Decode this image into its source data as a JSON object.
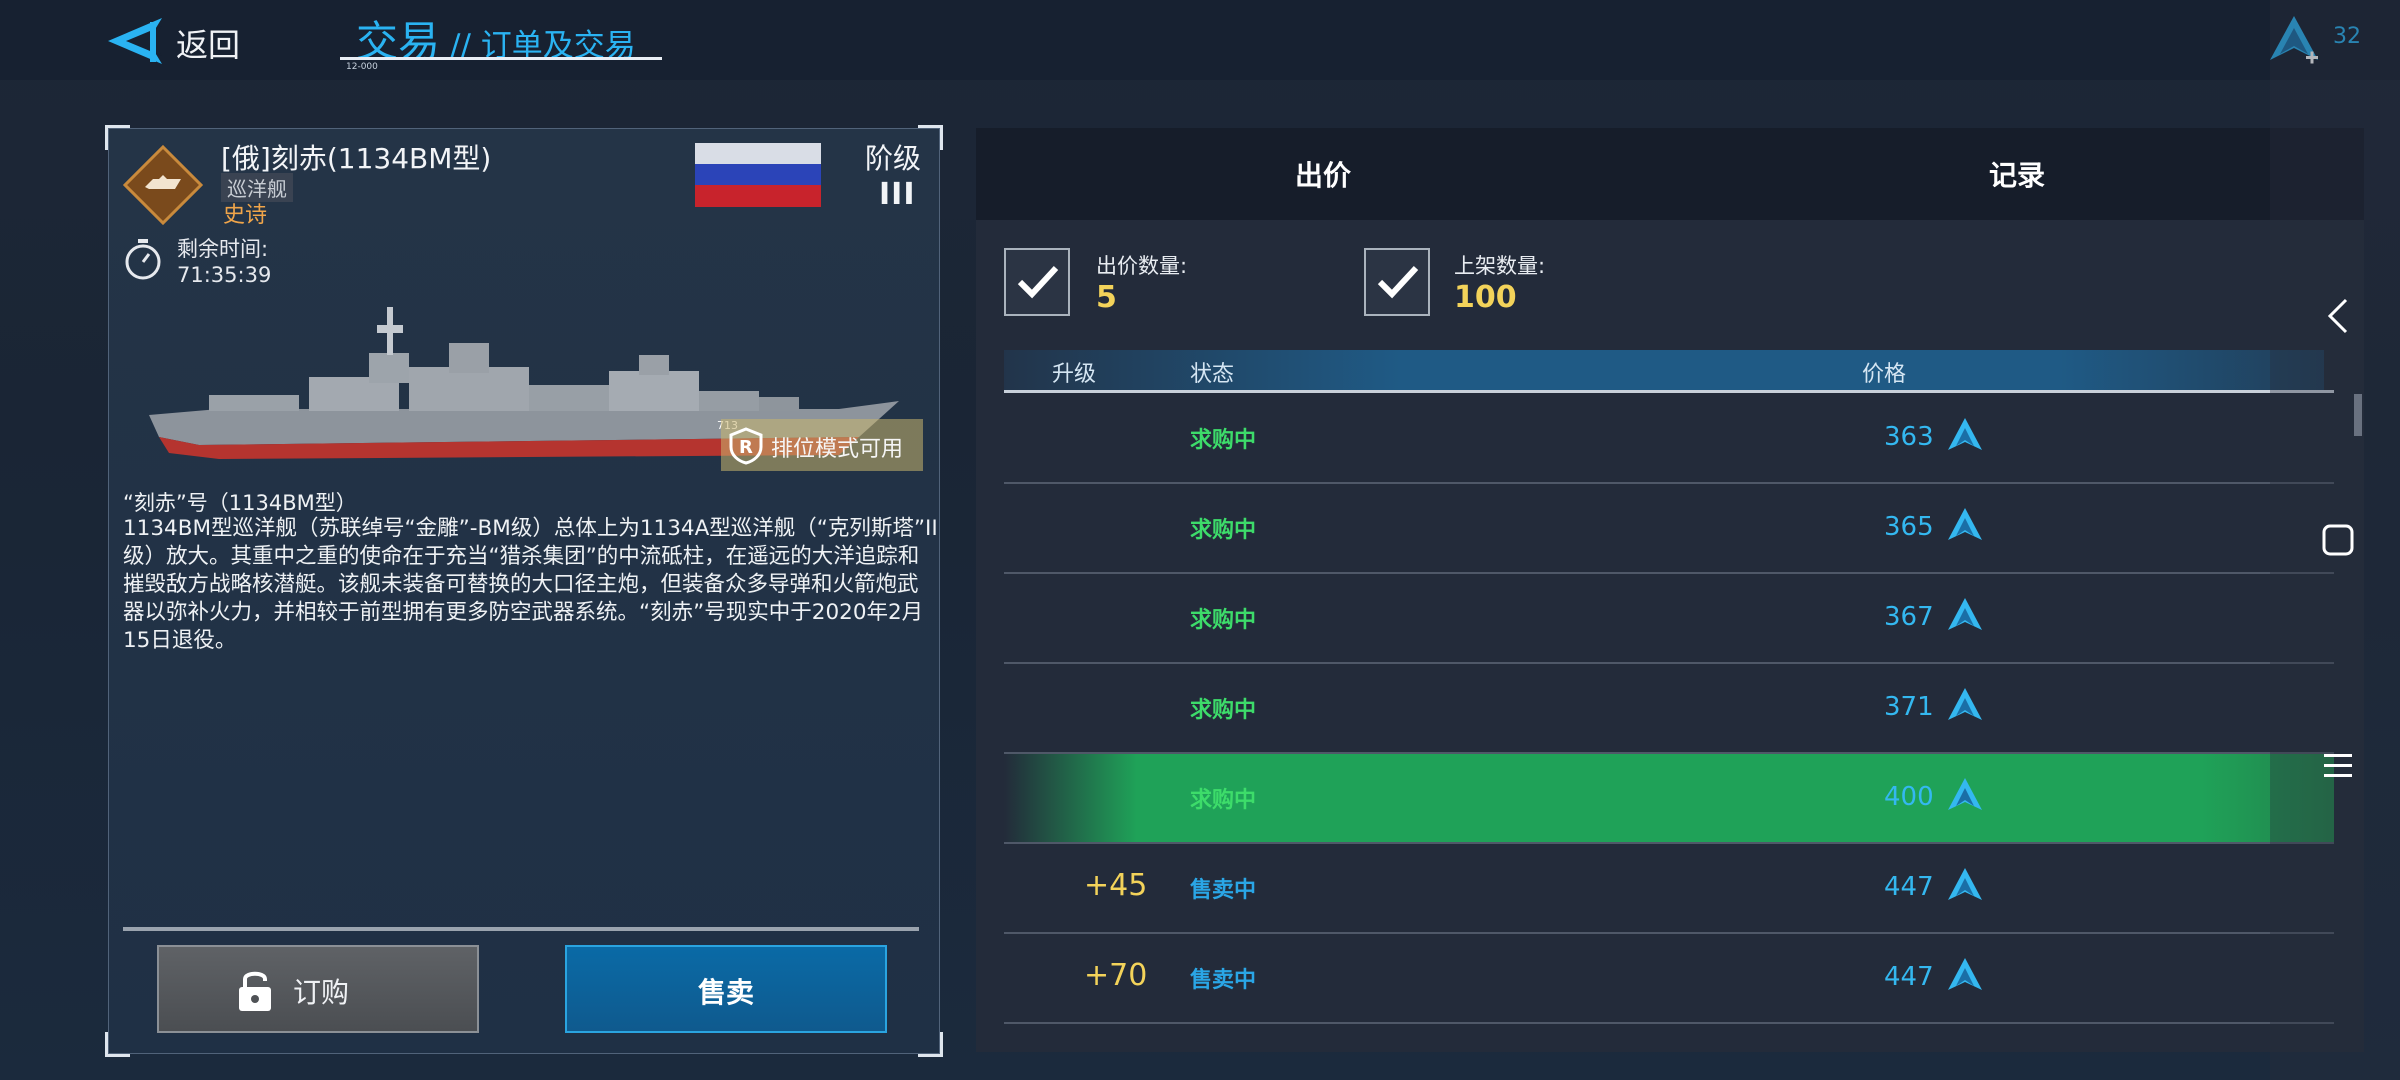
{
  "topbar": {
    "back_label": "返回",
    "title": "交易",
    "subtitle": "// 订单及交易",
    "tiny_text": "12-000",
    "currency_value": "32"
  },
  "ship": {
    "name": "[俄]刻赤(1134BM型)",
    "type": "巡洋舰",
    "rarity": "史诗",
    "tier_label": "阶级",
    "tier_value": "III",
    "timer_label": "剩余时间:",
    "timer_value": "71:35:39",
    "ranked_label": "排位模式可用",
    "hull_number": "713",
    "desc_title": "“刻赤”号（1134BM型）",
    "description": "1134BM型巡洋舰（苏联绰号“金雕”-BM级）总体上为1134A型巡洋舰（“克列斯塔”II级）放大。其重中之重的使命在于充当“猎杀集团”的中流砥柱，在遥远的大洋追踪和摧毁敌方战略核潜艇。该舰未装备可替换的大口径主炮，但装备众多导弹和火箭炮武器以弥补火力，并相较于前型拥有更多防空武器系统。“刻赤”号现实中于2020年2月15日退役。"
  },
  "actions": {
    "order_label": "订购",
    "sell_label": "售卖"
  },
  "tabs": {
    "bid": "出价",
    "record": "记录"
  },
  "filters": {
    "bid_count_label": "出价数量:",
    "bid_count_value": "5",
    "list_count_label": "上架数量:",
    "list_count_value": "100"
  },
  "table": {
    "headers": {
      "upgrade": "升级",
      "status": "状态",
      "price": "价格"
    },
    "rows": [
      {
        "upgrade": "",
        "status": "求购中",
        "price": "363"
      },
      {
        "upgrade": "",
        "status": "求购中",
        "price": "365"
      },
      {
        "upgrade": "",
        "status": "求购中",
        "price": "367"
      },
      {
        "upgrade": "",
        "status": "求购中",
        "price": "371"
      },
      {
        "upgrade": "",
        "status": "求购中",
        "price": "400"
      },
      {
        "upgrade": "+45",
        "status": "售卖中",
        "price": "447"
      },
      {
        "upgrade": "+70",
        "status": "售卖中",
        "price": "447"
      }
    ]
  },
  "colors": {
    "accent": "#2ab3f2",
    "buying": "#3ddc6a",
    "selling": "#2aa6e6",
    "highlight_row": "#1fa258",
    "rarity": "#f0a54a",
    "upgrade": "#f3d35a"
  }
}
